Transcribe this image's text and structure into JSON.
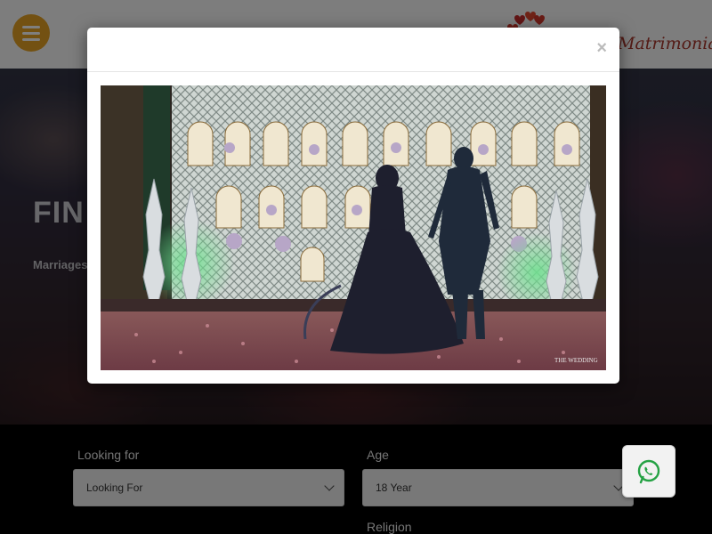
{
  "header": {
    "menu_icon": "hamburger-icon",
    "logo_text": "Matrimonial",
    "brand_color": "#e6a325",
    "logo_color": "#a8372c"
  },
  "hero": {
    "title": "FIN",
    "subtitle": "Marriages"
  },
  "search": {
    "looking_for_label": "Looking for",
    "looking_for_value": "Looking For",
    "age_label": "Age",
    "age_value": "18 Year",
    "religion_label": "Religion"
  },
  "whatsapp": {
    "icon": "whatsapp-icon",
    "color": "#25a244"
  },
  "modal": {
    "close_label": "×",
    "video_watermark": "THE WEDDING"
  }
}
